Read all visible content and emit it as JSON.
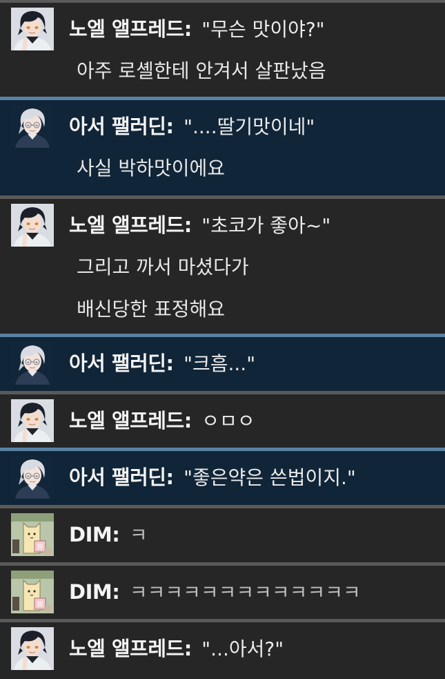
{
  "messages": [
    {
      "speaker": "노엘 앨프레드",
      "avatar": "noel-avatar",
      "theme": "dark",
      "quote": "\"무슨 맛이야?\"",
      "extra": [
        "아주 로셸한테 안겨서 살판났음"
      ]
    },
    {
      "speaker": "아서 팰러딘",
      "avatar": "arthur-avatar",
      "theme": "blue",
      "quote": "\"....딸기맛이네\"",
      "extra": [
        "사실 박하맛이에요"
      ]
    },
    {
      "speaker": "노엘 앨프레드",
      "avatar": "noel-avatar",
      "theme": "dark",
      "quote": "\"초코가 좋아~\"",
      "extra": [
        "그리고 까서 마셨다가",
        "배신당한 표정해요"
      ]
    },
    {
      "speaker": "아서 팰러딘",
      "avatar": "arthur-avatar",
      "theme": "blue",
      "quote": "\"크흠...\"",
      "extra": []
    },
    {
      "speaker": "노엘 앨프레드",
      "avatar": "noel-avatar",
      "theme": "dark",
      "quote": "ㅇㅁㅇ",
      "extra": []
    },
    {
      "speaker": "아서 팰러딘",
      "avatar": "arthur-avatar",
      "theme": "blue",
      "quote": "\"좋은약은 쓴법이지.\"",
      "extra": []
    },
    {
      "speaker": "DIM",
      "avatar": "dim-avatar",
      "theme": "dark",
      "quote": "ㅋ",
      "quote_style": "light",
      "extra": []
    },
    {
      "speaker": "DIM",
      "avatar": "dim-avatar",
      "theme": "dark",
      "quote": "ㅋㅋㅋㅋㅋㅋㅋㅋㅋㅋㅋㅋㅋ",
      "quote_style": "light",
      "extra": []
    },
    {
      "speaker": "노엘 앨프레드",
      "avatar": "noel-avatar",
      "theme": "dark",
      "quote": "\"...아서?\"",
      "extra": []
    }
  ],
  "separator": ":",
  "colors": {
    "dark_bg": "#262626",
    "blue_bg": "#112538",
    "divider": "#5a5a5a",
    "blue_divider": "#5882a4",
    "text": "#e6e6e6"
  }
}
